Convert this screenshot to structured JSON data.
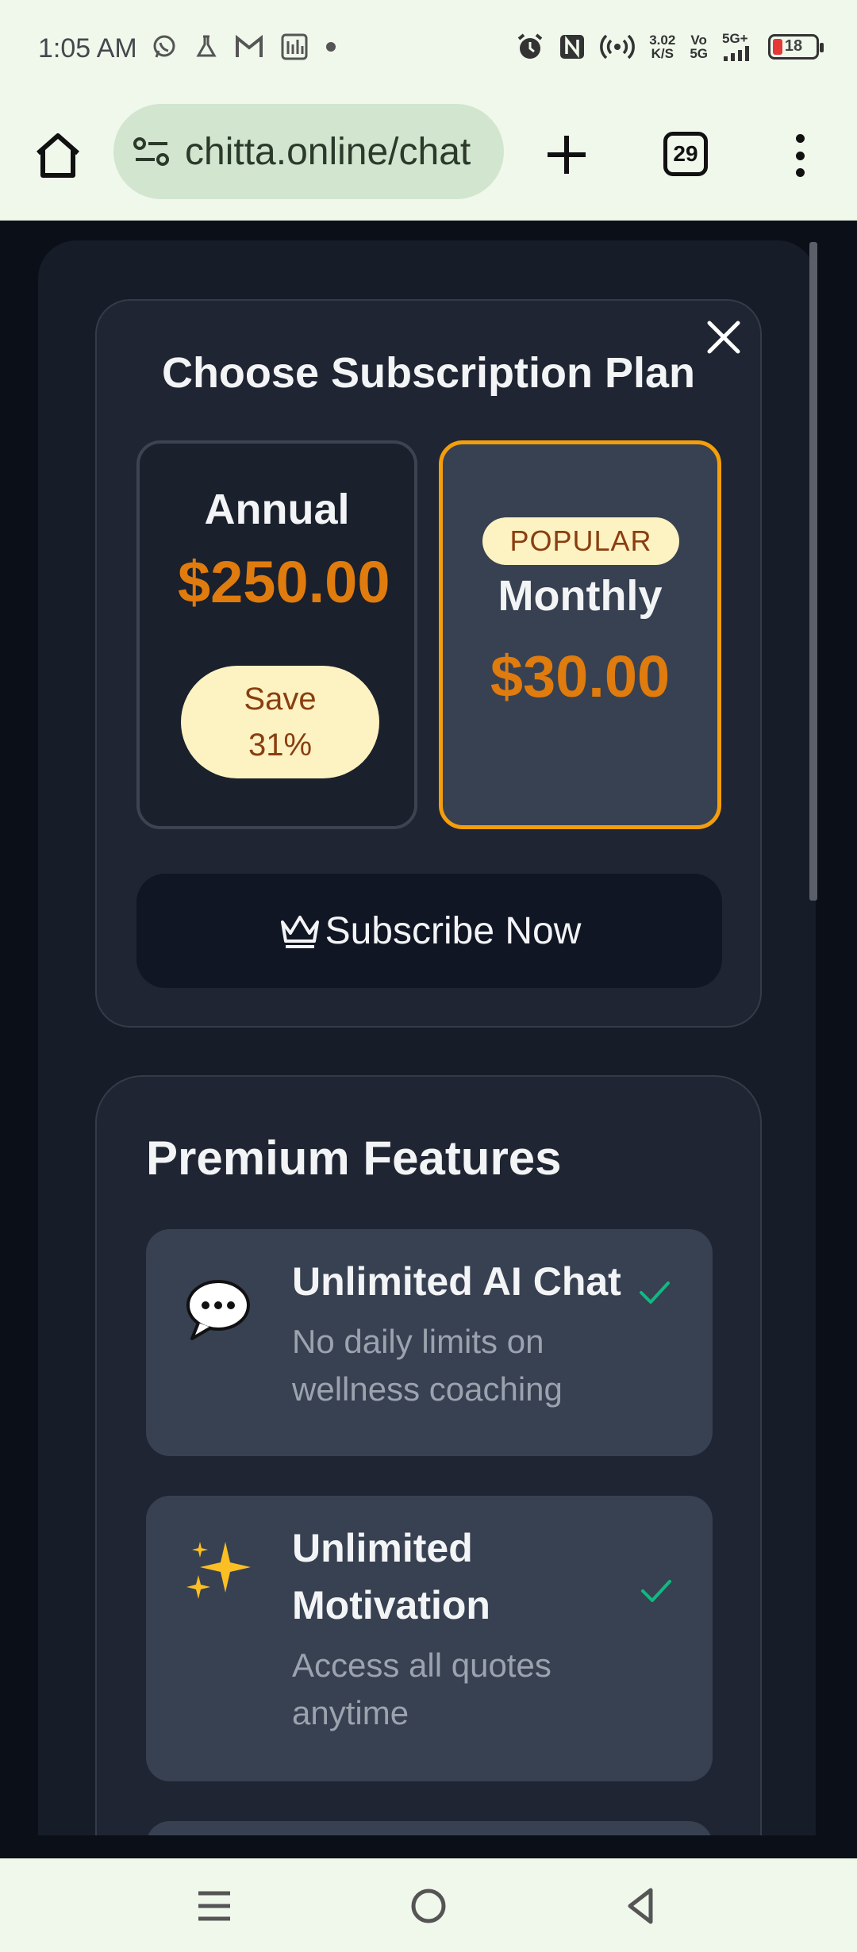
{
  "status_bar": {
    "time": "1:05 AM",
    "net_speed_value": "3.02",
    "net_speed_unit": "K/S",
    "volte_top": "Vo",
    "volte_bottom": "5G",
    "network": "5G+",
    "battery": "18"
  },
  "browser": {
    "url": "chitta.online/chat",
    "tab_count": "29"
  },
  "plan_dialog": {
    "title": "Choose Subscription Plan",
    "annual": {
      "name": "Annual",
      "price": "$250.00",
      "save_line1": "Save",
      "save_line2": "31%"
    },
    "monthly": {
      "badge": "POPULAR",
      "name": "Monthly",
      "price": "$30.00"
    },
    "subscribe_label": "Subscribe Now"
  },
  "features": {
    "title": "Premium Features",
    "items": [
      {
        "title": "Unlimited AI Chat",
        "desc_line1": "No daily limits on",
        "desc_line2": "wellness coaching",
        "icon": "speech-bubble-icon"
      },
      {
        "title_line1": "Unlimited",
        "title_line2": "Motivation",
        "desc_line1": "Access all quotes",
        "desc_line2": "anytime",
        "icon": "sparkles-icon"
      }
    ]
  },
  "colors": {
    "accent_orange": "#e07b0e",
    "selected_border": "#f59e0b",
    "check_green": "#10b981"
  }
}
